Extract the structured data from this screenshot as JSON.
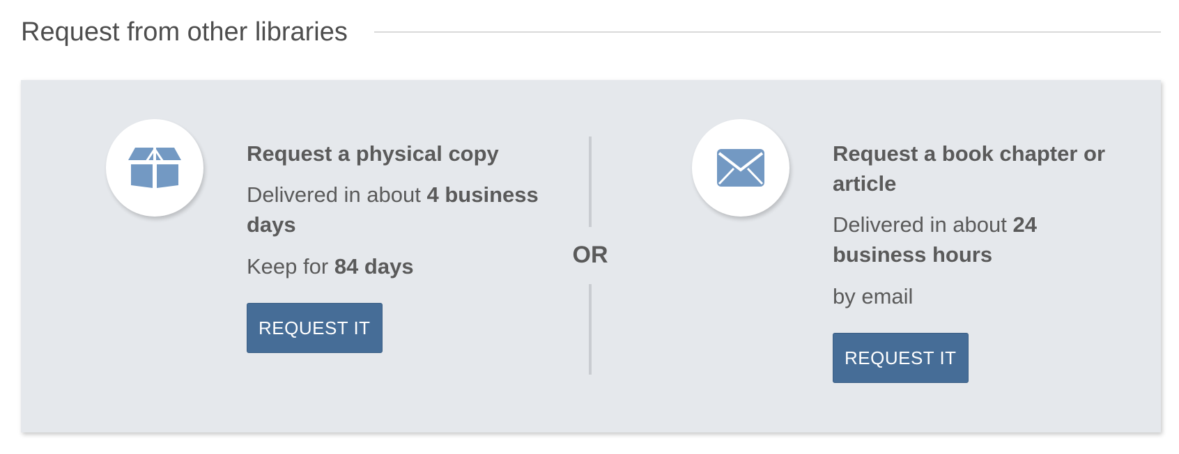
{
  "section": {
    "title": "Request from other libraries"
  },
  "physical": {
    "icon": "open-box-icon",
    "title": "Request a physical copy",
    "delivery_prefix": "Delivered in about ",
    "delivery_value": "4 business days",
    "keep_prefix": "Keep for ",
    "keep_value": "84 days",
    "button_label": "REQUEST IT"
  },
  "separator": {
    "label": "OR"
  },
  "chapter": {
    "icon": "envelope-icon",
    "title": "Request a book chapter or article",
    "delivery_prefix": "Delivered in about ",
    "delivery_value": "24 business hours",
    "method": "by email",
    "button_label": "REQUEST IT"
  },
  "colors": {
    "panel_background": "#e5e8ec",
    "button": "#466d97",
    "icon": "#7399c3",
    "text": "#5a5a5a"
  }
}
